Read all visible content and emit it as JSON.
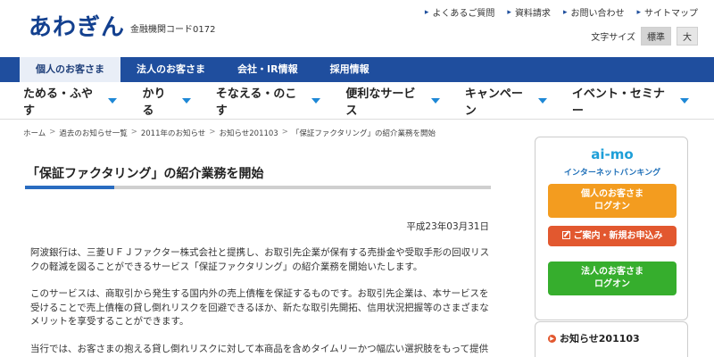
{
  "header": {
    "logo": "あわぎん",
    "bank_code": "金融機関コード0172",
    "util_links": [
      "よくあるご質問",
      "資料請求",
      "お問い合わせ",
      "サイトマップ"
    ],
    "font_size_label": "文字サイズ",
    "font_sizes": [
      "標準",
      "大"
    ]
  },
  "tabs": [
    "個人のお客さま",
    "法人のお客さま",
    "会社・IR情報",
    "採用情報"
  ],
  "categories": [
    "ためる・ふやす",
    "かりる",
    "そなえる・のこす",
    "便利なサービス",
    "キャンペーン",
    "イベント・セミナー"
  ],
  "breadcrumb": [
    "ホーム",
    "過去のお知らせ一覧",
    "2011年のお知らせ",
    "お知らせ201103",
    "「保証ファクタリング」の紹介業務を開始"
  ],
  "article": {
    "title": "「保証ファクタリング」の紹介業務を開始",
    "date": "平成23年03月31日",
    "paragraphs": [
      "阿波銀行は、三菱ＵＦＪファクター株式会社と提携し、お取引先企業が保有する売掛金や受取手形の回収リスクの軽減を図ることができるサービス「保証ファクタリング」の紹介業務を開始いたします。",
      "このサービスは、商取引から発生する国内外の売上債権を保証するものです。お取引先企業は、本サービスを受けることで売上債権の貸し倒れリスクを回避できるほか、新たな取引先開拓、信用状況把握等のさまざまなメリットを享受することができます。",
      "当行では、お客さまの抱える貸し倒れリスクに対して本商品を含めタイムリーかつ幅広い選択肢をもって提供"
    ]
  },
  "sidebar": {
    "aimo": "ai-mo",
    "aimo_sub": "インターネットバンキング",
    "personal_login": [
      "個人のお客さま",
      "ログオン"
    ],
    "guide": "ご案内・新規お申込み",
    "corporate_login": [
      "法人のお客さま",
      "ログオン"
    ],
    "news_title": "お知らせ201103"
  }
}
